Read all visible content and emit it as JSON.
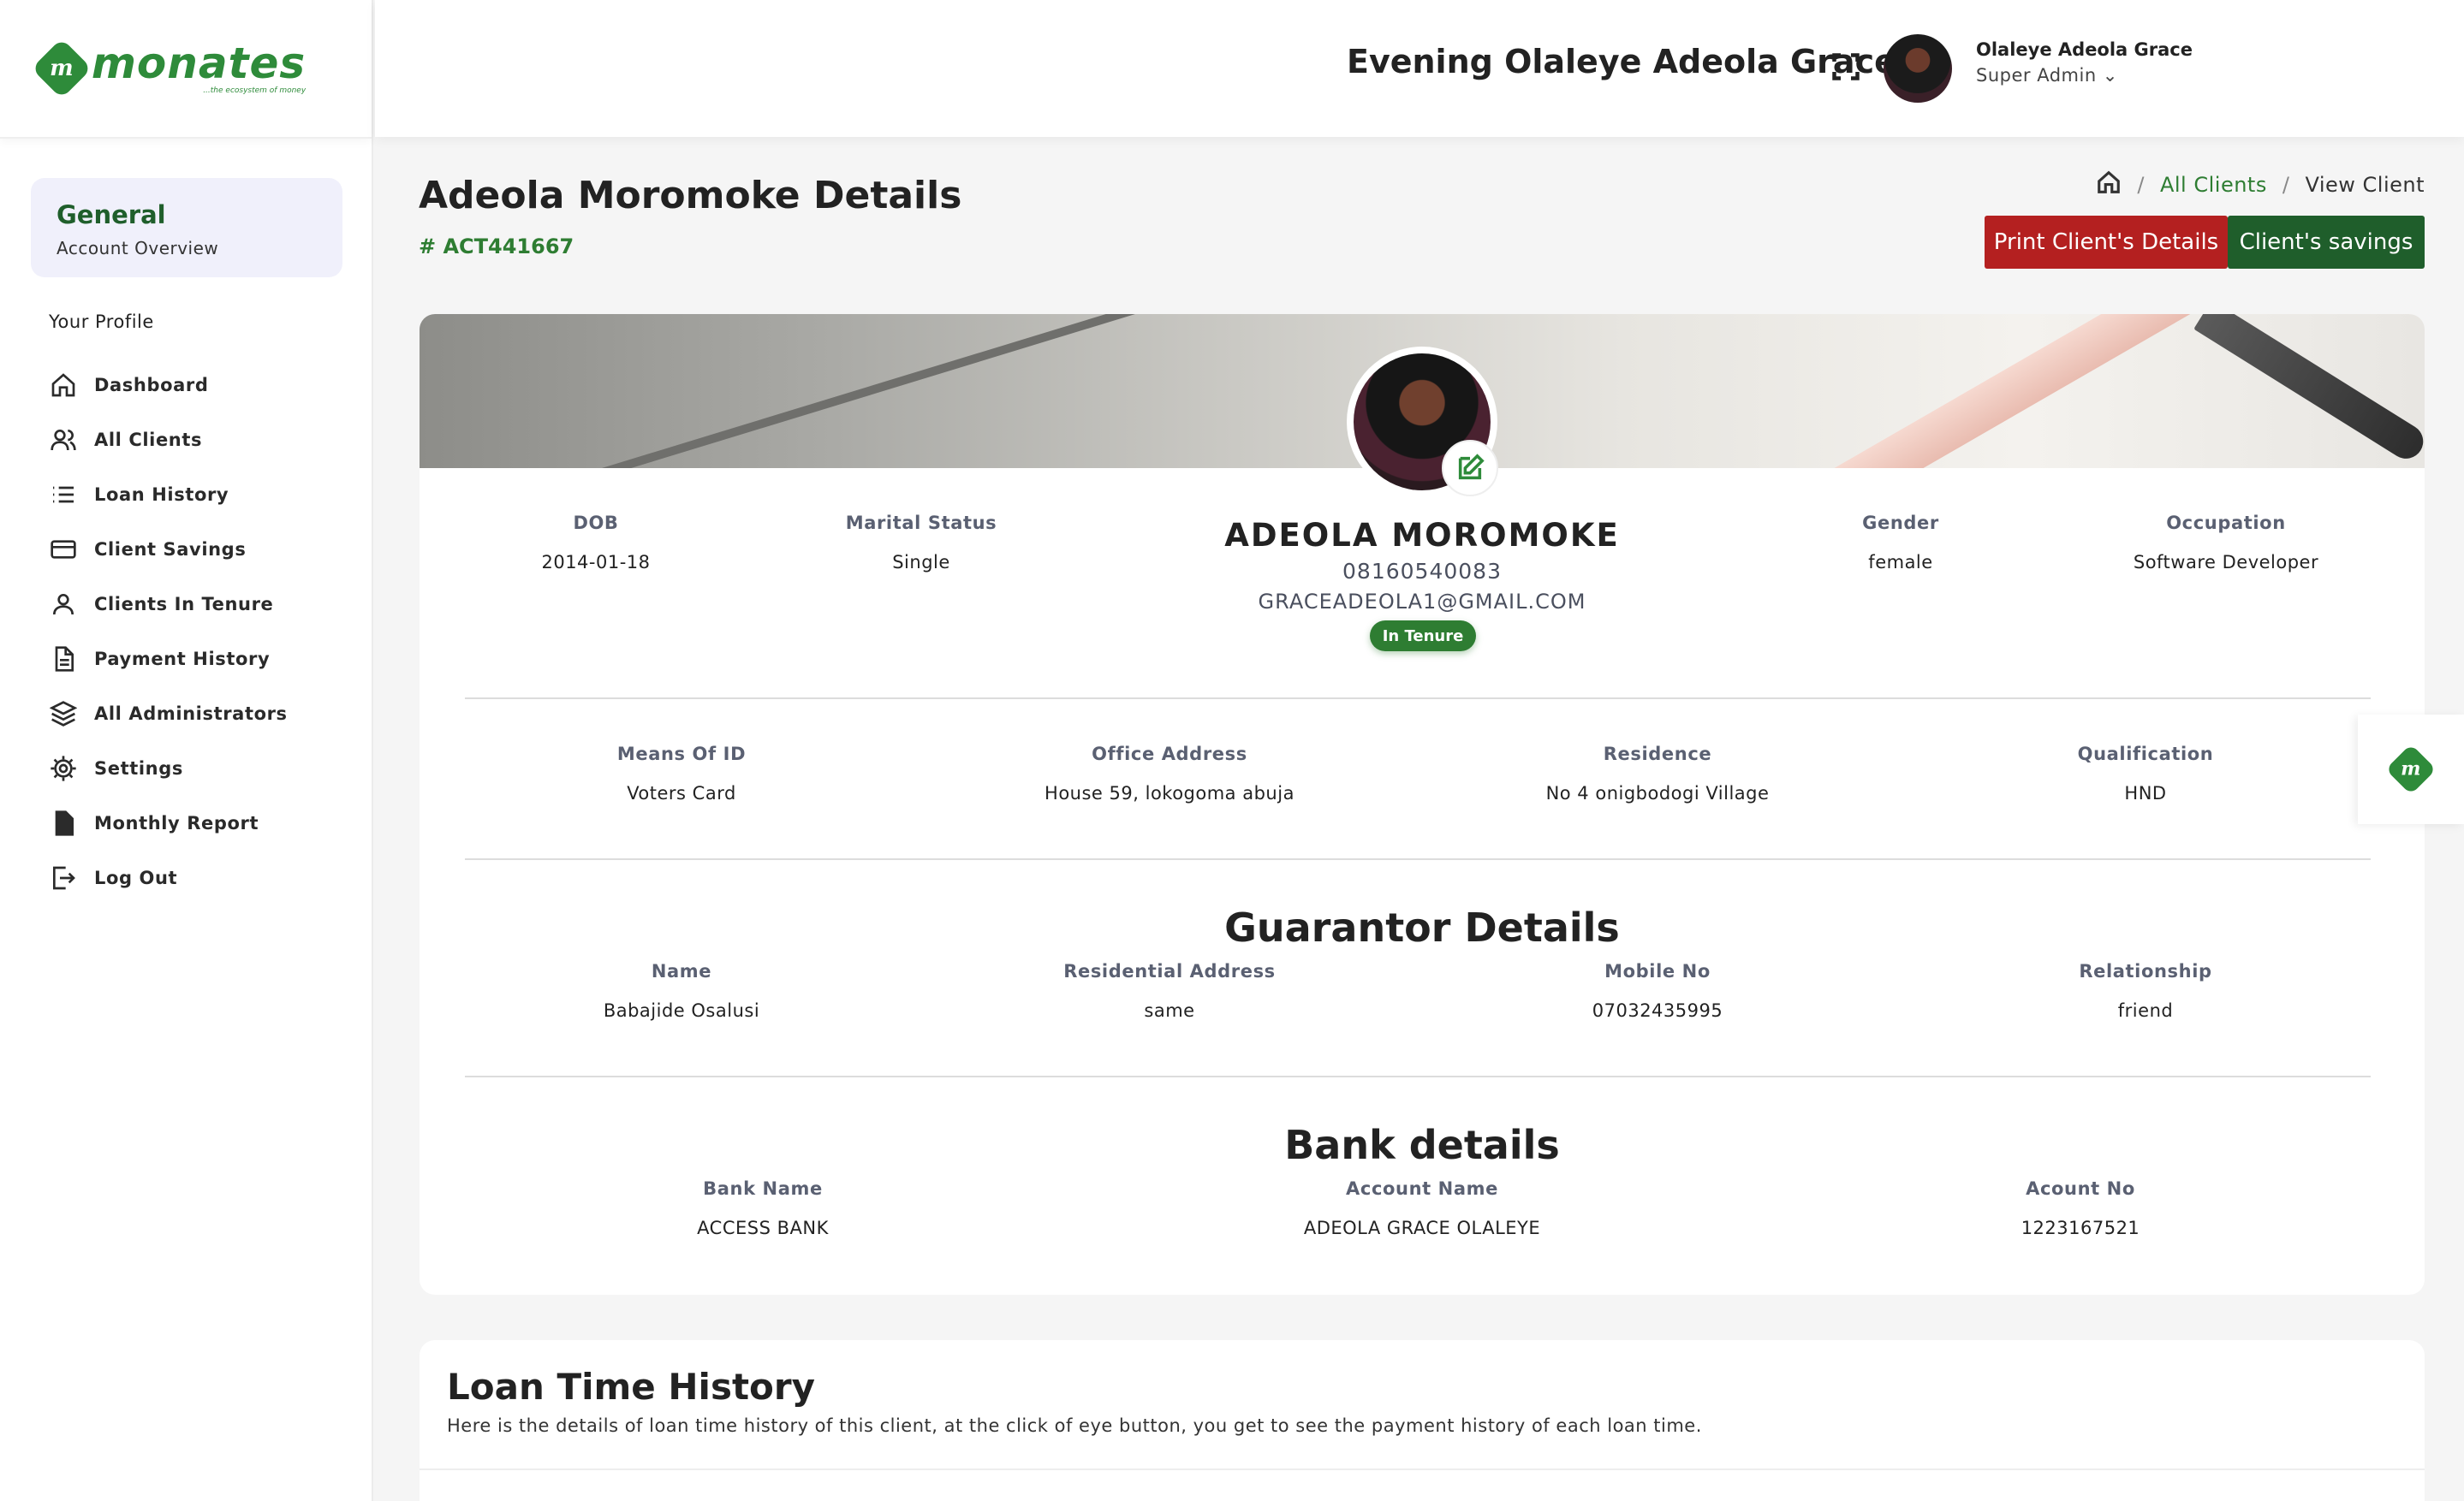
{
  "brand": {
    "name": "monates",
    "tagline": "...the ecosystem of money"
  },
  "sidebar": {
    "general_title": "General",
    "general_sub": "Account Overview",
    "profile_label": "Your Profile",
    "items": [
      {
        "label": "Dashboard",
        "icon": "home-icon"
      },
      {
        "label": "All Clients",
        "icon": "users-icon"
      },
      {
        "label": "Loan History",
        "icon": "list-icon"
      },
      {
        "label": "Client Savings",
        "icon": "credit-card-icon"
      },
      {
        "label": "Clients In Tenure",
        "icon": "user-icon"
      },
      {
        "label": "Payment History",
        "icon": "document-icon"
      },
      {
        "label": "All Administrators",
        "icon": "layers-icon"
      },
      {
        "label": "Settings",
        "icon": "gear-icon"
      },
      {
        "label": "Monthly Report",
        "icon": "file-icon"
      },
      {
        "label": "Log Out",
        "icon": "logout-icon"
      }
    ]
  },
  "header": {
    "greeting": "Evening Olaleye Adeola Grace,",
    "user_name": "Olaleye Adeola Grace",
    "user_role": "Super Admin ⌄"
  },
  "page": {
    "title": "Adeola Moromoke Details",
    "account_code": "# ACT441667",
    "breadcrumb": {
      "sep": "/",
      "all_clients": "All Clients",
      "current": "View Client"
    },
    "print_button": "Print Client's Details",
    "savings_button": "Client's savings"
  },
  "client": {
    "name": "ADEOLA MOROMOKE",
    "phone": "08160540083",
    "email": "GRACEADEOLA1@GMAIL.COM",
    "status": "In Tenure",
    "dob_label": "DOB",
    "dob": "2014-01-18",
    "marital_label": "Marital Status",
    "marital": "Single",
    "gender_label": "Gender",
    "gender": "female",
    "occupation_label": "Occupation",
    "occupation": "Software Developer",
    "id_label": "Means Of ID",
    "id": "Voters Card",
    "office_label": "Office Address",
    "office": "House 59, lokogoma abuja",
    "residence_label": "Residence",
    "residence": "No 4 onigbodogi Village",
    "qualification_label": "Qualification",
    "qualification": "HND"
  },
  "guarantor": {
    "title": "Guarantor Details",
    "name_label": "Name",
    "name": "Babajide Osalusi",
    "address_label": "Residential Address",
    "address": "same",
    "mobile_label": "Mobile No",
    "mobile": "07032435995",
    "relationship_label": "Relationship",
    "relationship": "friend"
  },
  "bank": {
    "title": "Bank details",
    "bank_label": "Bank Name",
    "bank": "ACCESS BANK",
    "account_name_label": "Account Name",
    "account_name": "ADEOLA GRACE OLALEYE",
    "account_no_label": "Acount No",
    "account_no": "1223167521"
  },
  "loan_history": {
    "title": "Loan Time History",
    "description": "Here is the details of loan time history of this client, at the click of eye button, you get to see the payment history of each loan time."
  },
  "colors": {
    "brand_green": "#2e8b3a",
    "dark_green": "#1f5e2b",
    "red": "#b42020"
  }
}
